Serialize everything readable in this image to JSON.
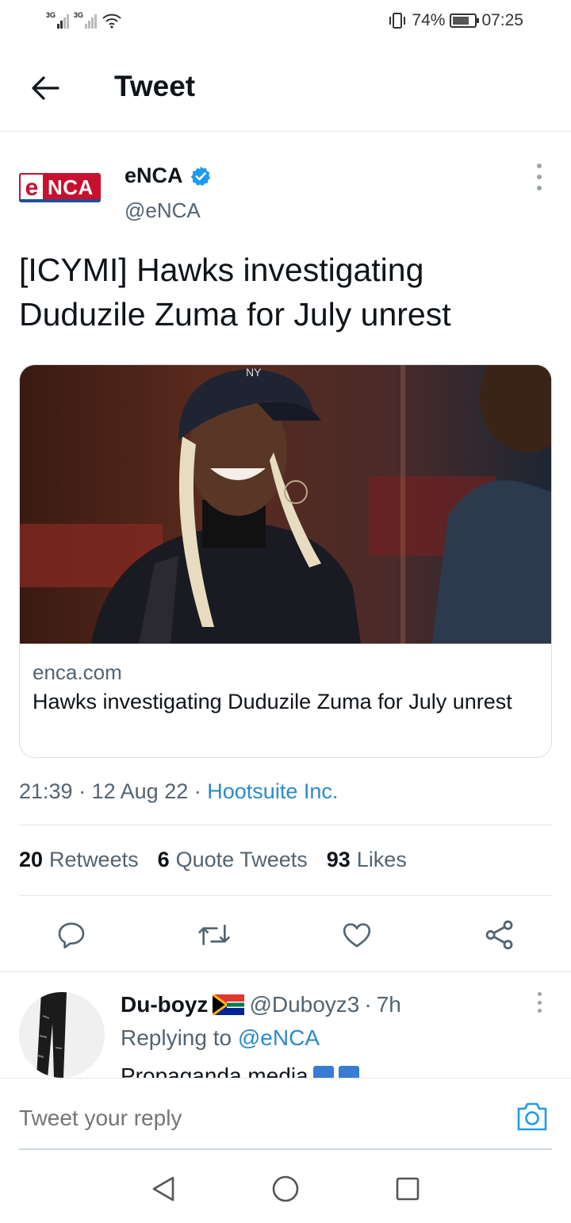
{
  "status_bar": {
    "signal_1": "3G",
    "signal_2": "3G",
    "battery_percent": "74%",
    "battery_level": 0.74,
    "time": "07:25"
  },
  "header": {
    "title": "Tweet"
  },
  "tweet": {
    "logo_letter": "e",
    "logo_rest": "NCA",
    "author_name": "eNCA",
    "author_handle": "@eNCA",
    "text": "[ICYMI] Hawks investigating Duduzile Zuma for July unrest",
    "card": {
      "domain": "enca.com",
      "title": "Hawks investigating Duduzile Zuma for July unrest"
    },
    "time": "21:39",
    "date": "12 Aug 22",
    "source": "Hootsuite Inc.",
    "separator": "·",
    "stats": {
      "retweets_count": "20",
      "retweets_label": "Retweets",
      "quotes_count": "6",
      "quotes_label": "Quote Tweets",
      "likes_count": "93",
      "likes_label": "Likes"
    }
  },
  "reply": {
    "name": "Du-boyz",
    "handle": "@Duboyz3",
    "age": "7h",
    "replying_prefix": "Replying to",
    "replying_to": "@eNCA",
    "text": "Propaganda media"
  },
  "compose": {
    "placeholder": "Tweet your reply"
  },
  "colors": {
    "accent": "#1d9bf0",
    "link": "#2b8acb",
    "secondary_text": "#536471",
    "enca_red": "#c8102e"
  }
}
